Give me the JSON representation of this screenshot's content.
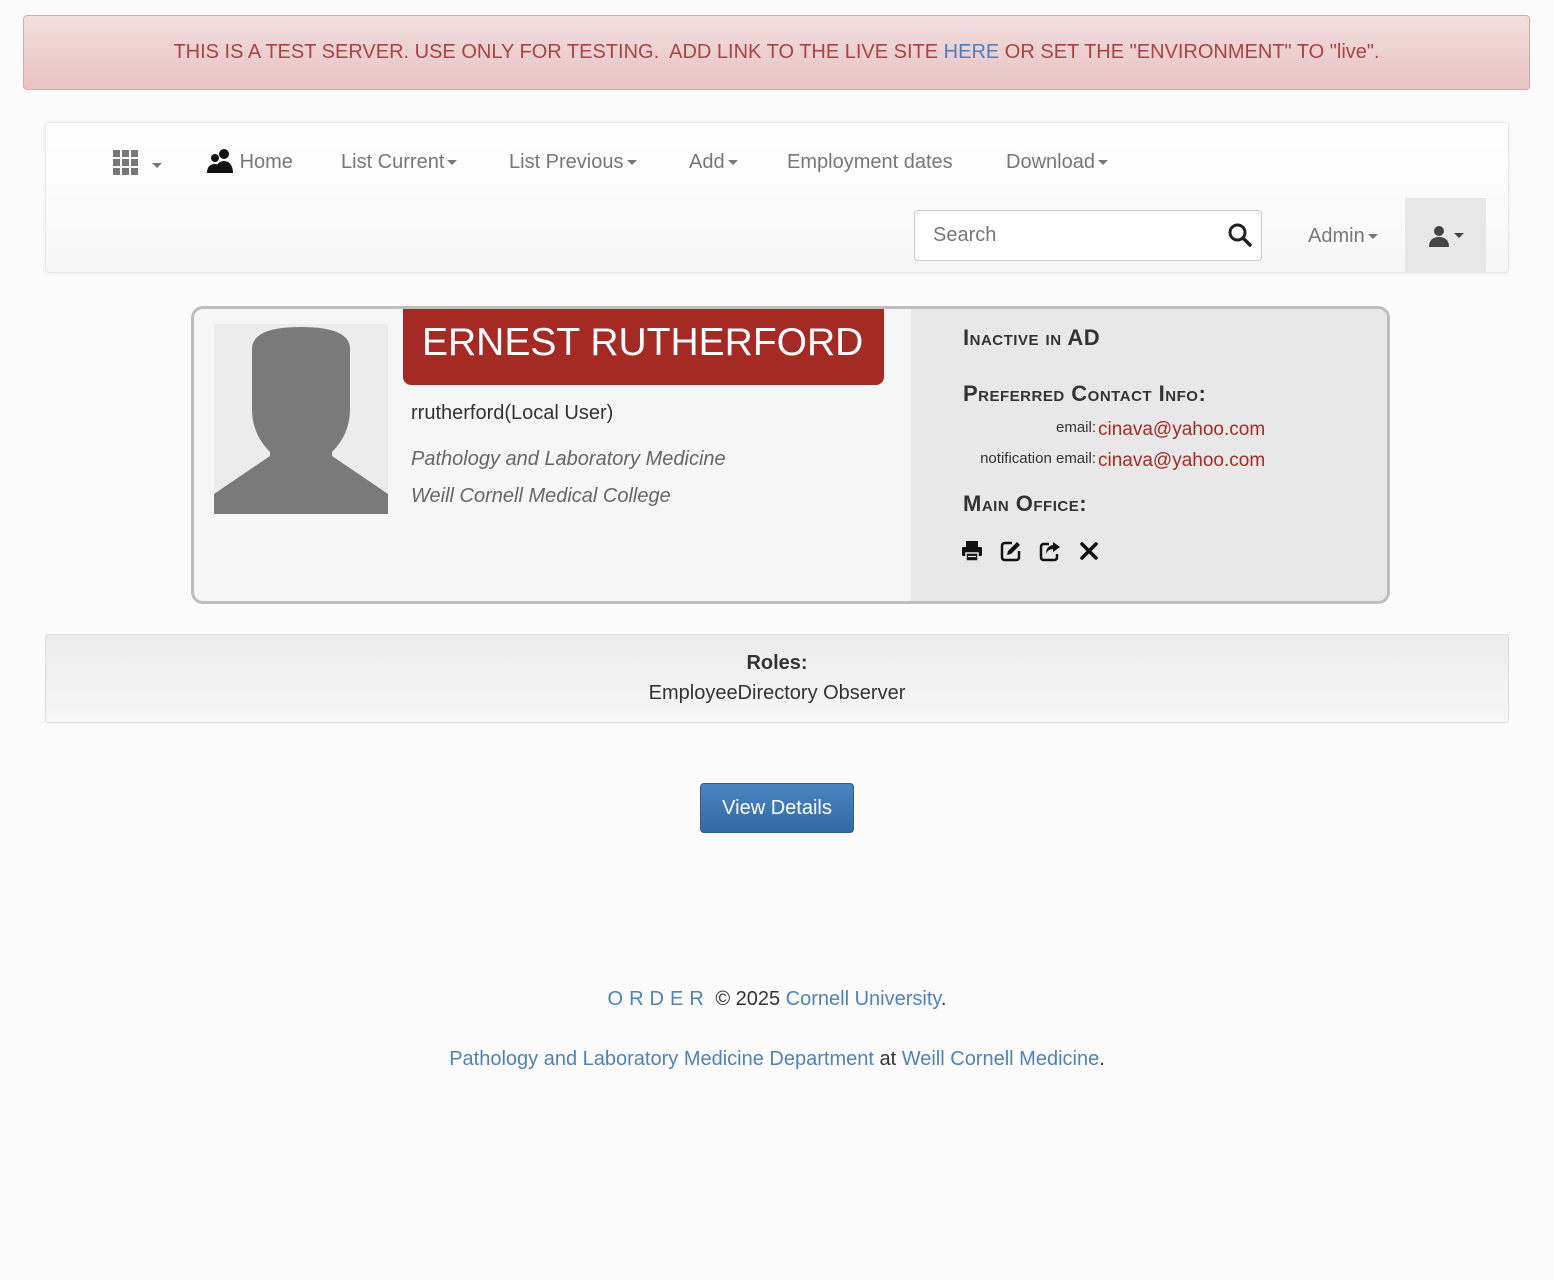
{
  "alert": {
    "prefix": "THIS IS A TEST SERVER. USE ONLY FOR TESTING.  ADD LINK TO THE LIVE SITE ",
    "link": "HERE",
    "suffix": " OR SET THE \"ENVIRONMENT\" TO \"live\"."
  },
  "nav": {
    "home": "Home",
    "list_current": "List Current",
    "list_previous": "List Previous",
    "add": "Add",
    "employment_dates": "Employment dates",
    "download": "Download",
    "admin": "Admin"
  },
  "search": {
    "placeholder": "Search"
  },
  "profile": {
    "name": "ERNEST RUTHERFORD",
    "username": "rrutherford(Local User)",
    "department": "Pathology and Laboratory Medicine",
    "institution": "Weill Cornell Medical College",
    "status": "Inactive in AD",
    "contact_title": "Preferred Contact Info:",
    "email_label": "email:",
    "email": "cinava@yahoo.com",
    "notification_label": "notification email:",
    "notification_email": "cinava@yahoo.com",
    "office_title": "Main Office:"
  },
  "roles": {
    "title": "Roles:",
    "value": "EmployeeDirectory Observer"
  },
  "view_details": "View Details",
  "footer": {
    "order": "ORDER",
    "copyright": " © 2025 ",
    "university": "Cornell University",
    "period": ".",
    "department": "Pathology and Laboratory Medicine Department",
    "at": " at ",
    "wcm": "Weill Cornell Medicine"
  },
  "colors": {
    "brand_red": "#a52a24",
    "link_blue": "#4d82bf",
    "button_blue": "#3f78b6",
    "alert_text": "#a94442"
  }
}
